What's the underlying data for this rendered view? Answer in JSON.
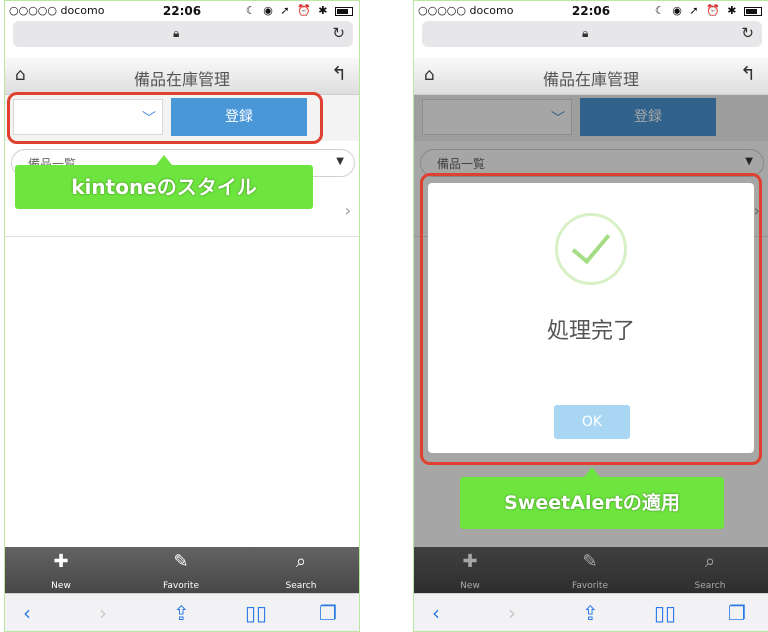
{
  "status": {
    "carrier": "○○○○○ docomo",
    "time": "22:06"
  },
  "app": {
    "title": "備品在庫管理",
    "register_label": "登録",
    "view_select": "備品一覧"
  },
  "annotations": {
    "left_label": "kintoneのスタイル",
    "right_label": "SweetAlertの適用"
  },
  "dialog": {
    "title": "処理完了",
    "ok_label": "OK"
  },
  "footer": {
    "new_label": "New",
    "favorite_label": "Favorite",
    "search_label": "Search"
  },
  "colors": {
    "register": "#4a97d8",
    "callout": "#e0402f",
    "label_bg": "#6ee43f",
    "check": "#a5dc86",
    "ok": "#a9d6f3"
  },
  "icons": [
    "home-icon",
    "back-icon",
    "lock-icon",
    "reload-icon",
    "chevron-down-icon",
    "caret-down-icon",
    "chevron-right-icon",
    "plus-icon",
    "pin-icon",
    "search-icon",
    "share-icon",
    "bookmarks-icon",
    "tabs-icon",
    "checkmark-icon"
  ]
}
